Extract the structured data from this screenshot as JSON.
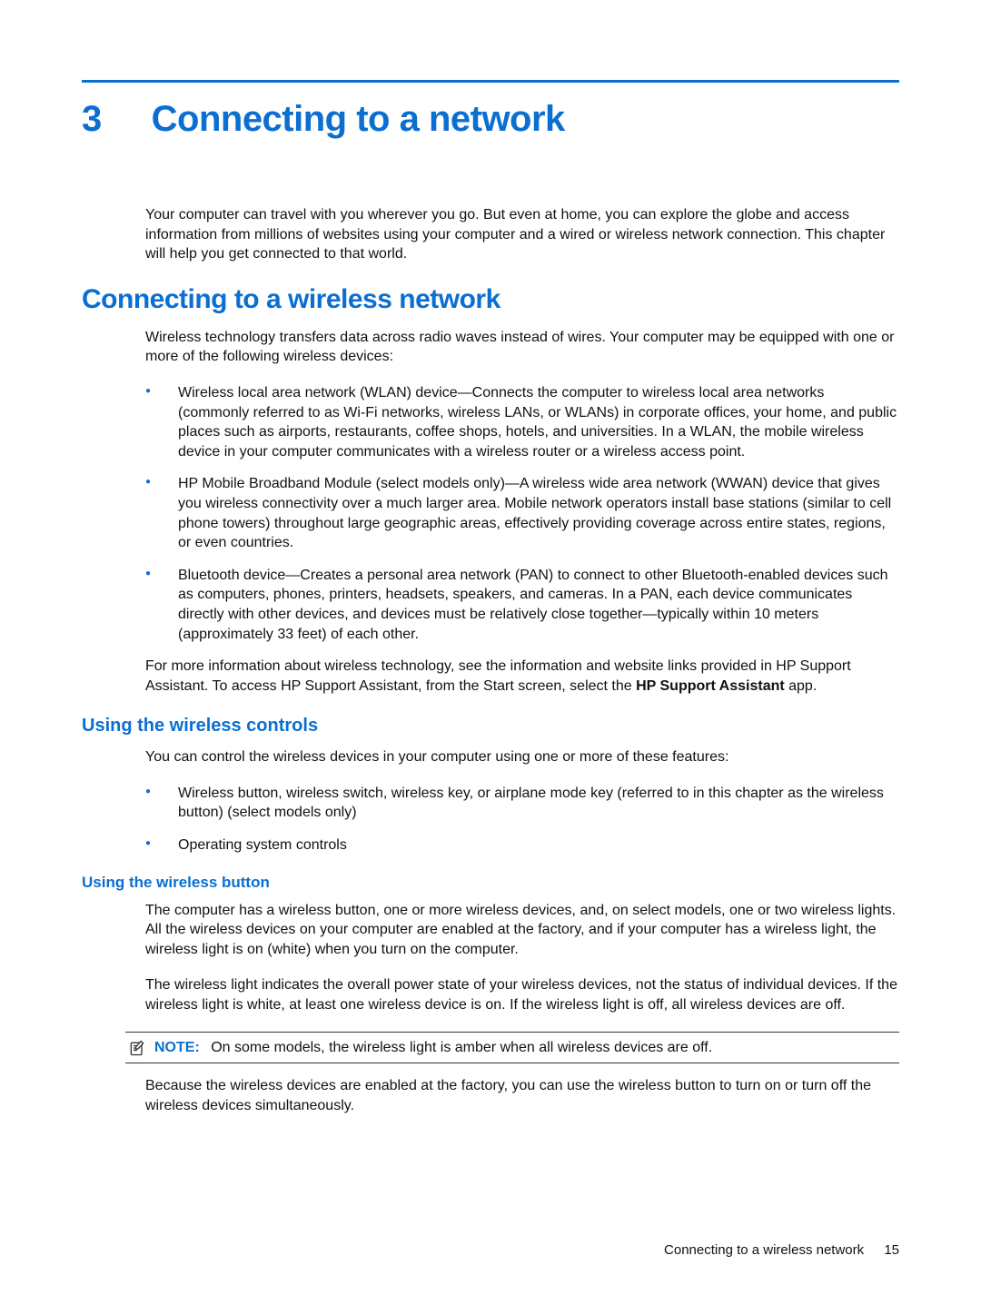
{
  "chapter": {
    "number": "3",
    "title": "Connecting to a network"
  },
  "intro": "Your computer can travel with you wherever you go. But even at home, you can explore the globe and access information from millions of websites using your computer and a wired or wireless network connection. This chapter will help you get connected to that world.",
  "section1": {
    "heading": "Connecting to a wireless network",
    "p1": "Wireless technology transfers data across radio waves instead of wires. Your computer may be equipped with one or more of the following wireless devices:",
    "bullets": [
      "Wireless local area network (WLAN) device—Connects the computer to wireless local area networks (commonly referred to as Wi-Fi networks, wireless LANs, or WLANs) in corporate offices, your home, and public places such as airports, restaurants, coffee shops, hotels, and universities. In a WLAN, the mobile wireless device in your computer communicates with a wireless router or a wireless access point.",
      "HP Mobile Broadband Module (select models only)—A wireless wide area network (WWAN) device that gives you wireless connectivity over a much larger area. Mobile network operators install base stations (similar to cell phone towers) throughout large geographic areas, effectively providing coverage across entire states, regions, or even countries.",
      "Bluetooth device—Creates a personal area network (PAN) to connect to other Bluetooth-enabled devices such as computers, phones, printers, headsets, speakers, and cameras. In a PAN, each device communicates directly with other devices, and devices must be relatively close together—typically within 10 meters (approximately 33 feet) of each other."
    ],
    "p2a": "For more information about wireless technology, see the information and website links provided in HP Support Assistant. To access HP Support Assistant, from the Start screen, select the ",
    "p2bold": "HP Support Assistant",
    "p2b": " app."
  },
  "section2": {
    "heading": "Using the wireless controls",
    "p1": "You can control the wireless devices in your computer using one or more of these features:",
    "bullets": [
      "Wireless button, wireless switch, wireless key, or airplane mode key (referred to in this chapter as the wireless button) (select models only)",
      "Operating system controls"
    ]
  },
  "section3": {
    "heading": "Using the wireless button",
    "p1": "The computer has a wireless button, one or more wireless devices, and, on select models, one or two wireless lights. All the wireless devices on your computer are enabled at the factory, and if your computer has a wireless light, the wireless light is on (white) when you turn on the computer.",
    "p2": "The wireless light indicates the overall power state of your wireless devices, not the status of individual devices. If the wireless light is white, at least one wireless device is on. If the wireless light is off, all wireless devices are off.",
    "noteLabel": "NOTE:",
    "noteText": "On some models, the wireless light is amber when all wireless devices are off.",
    "p3": "Because the wireless devices are enabled at the factory, you can use the wireless button to turn on or turn off the wireless devices simultaneously."
  },
  "footer": {
    "text": "Connecting to a wireless network",
    "page": "15"
  }
}
